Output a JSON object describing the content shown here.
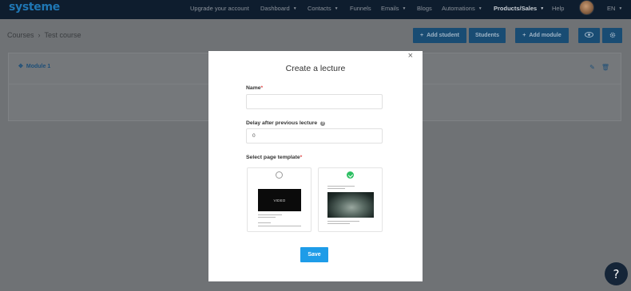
{
  "nav": {
    "logo": "systeme",
    "items": [
      {
        "label": "Upgrade your account",
        "has_caret": false
      },
      {
        "label": "Dashboard",
        "has_caret": true
      },
      {
        "label": "Contacts",
        "has_caret": true
      },
      {
        "label": "Funnels",
        "has_caret": false
      },
      {
        "label": "Emails",
        "has_caret": true
      },
      {
        "label": "Blogs",
        "has_caret": false
      },
      {
        "label": "Automations",
        "has_caret": true
      },
      {
        "label": "Products/Sales",
        "has_caret": true,
        "active": true
      },
      {
        "label": "Help",
        "has_caret": false
      }
    ],
    "language": "EN"
  },
  "breadcrumb": {
    "root": "Courses",
    "separator": "›",
    "current": "Test course"
  },
  "toolbar": {
    "add_student": "Add student",
    "students": "Students",
    "add_module": "Add module",
    "preview_icon": "eye-icon",
    "settings_icon": "gear-icon"
  },
  "module": {
    "label": "Module 1",
    "edit_icon": "pencil-icon",
    "delete_icon": "trash-icon"
  },
  "modal": {
    "title": "Create a lecture",
    "close": "×",
    "name_label": "Name",
    "name_value": "",
    "required_mark": "*",
    "delay_label": "Delay after previous lecture",
    "delay_help": "?",
    "delay_value": "0",
    "template_label": "Select page template",
    "templates": [
      {
        "name": "video-template",
        "selected": false,
        "thumb_text": "VIDEO"
      },
      {
        "name": "image-template",
        "selected": true
      }
    ],
    "save_label": "Save"
  },
  "help_bubble": "?",
  "colors": {
    "brand_blue": "#1f77b4",
    "primary_button": "#1e9ce8",
    "selected_green": "#2cbf62",
    "nav_bg": "#0e1d2e"
  }
}
